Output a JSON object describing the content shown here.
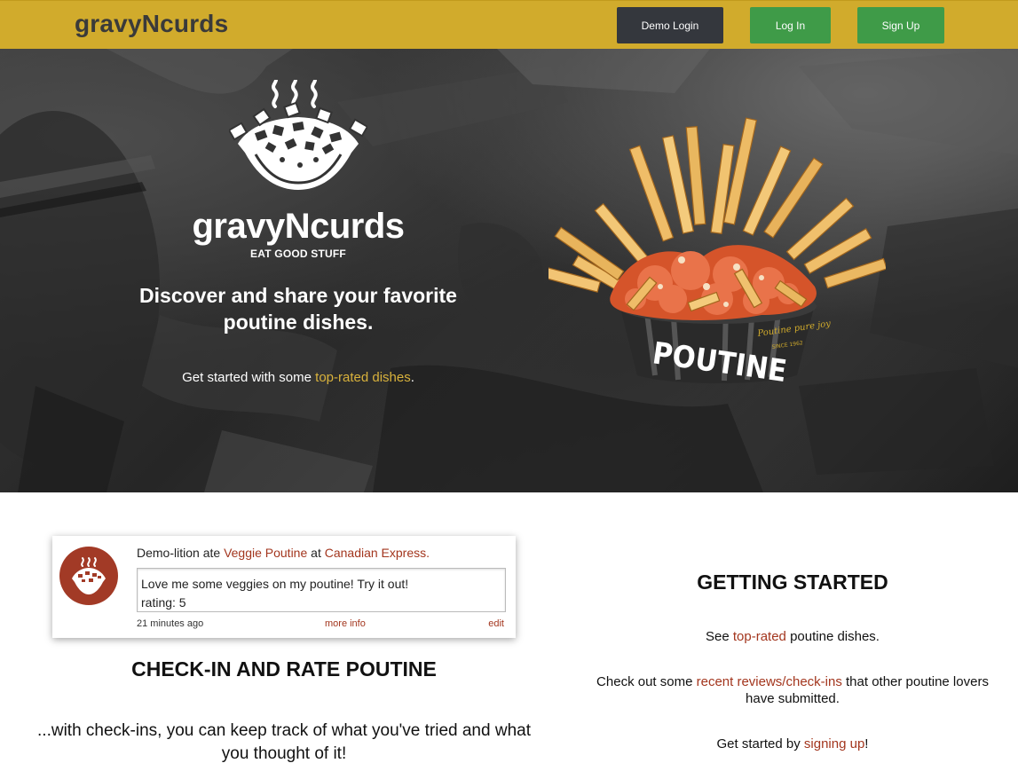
{
  "nav": {
    "brand": "gravyNcurds",
    "demo_login": "Demo Login",
    "log_in": "Log In",
    "sign_up": "Sign Up"
  },
  "hero": {
    "title": "gravyNcurds",
    "tagline": "EAT GOOD STUFF",
    "headline": "Discover and share your favorite poutine dishes.",
    "cta_prefix": "Get started with some ",
    "cta_link": "top-rated dishes",
    "cta_suffix": ".",
    "cup_label": "POUTINE",
    "cup_script": "Poutine pure joy",
    "cup_since": "SINCE 1962"
  },
  "checkin_card": {
    "user": "Demo-lition",
    "ate": " ate ",
    "dish": "Veggie Poutine",
    "at": " at ",
    "restaurant": "Canadian Express.",
    "body": "Love me some veggies on my poutine! Try it out!",
    "rating": "rating: 5",
    "time": "21 minutes ago",
    "more_info": "more info",
    "edit": "edit"
  },
  "checkin_section": {
    "title": "CHECK-IN AND RATE POUTINE",
    "description": "...with check-ins, you can keep track of what you've tried and what you thought of it!"
  },
  "getting_started": {
    "title": "GETTING STARTED",
    "line1_prefix": "See ",
    "line1_link": "top-rated",
    "line1_suffix": " poutine dishes.",
    "line2_prefix": "Check out some ",
    "line2_link": "recent reviews/check-ins",
    "line2_suffix": " that other poutine lovers have submitted.",
    "line3_prefix": "Get started by ",
    "line3_link": "signing up",
    "line3_suffix": "!"
  },
  "colors": {
    "navbar": "#d1ab2c",
    "demo_button": "#34373d",
    "green_button": "#3f9b48",
    "link_red": "#a3361e",
    "link_gold": "#d9b23c"
  }
}
